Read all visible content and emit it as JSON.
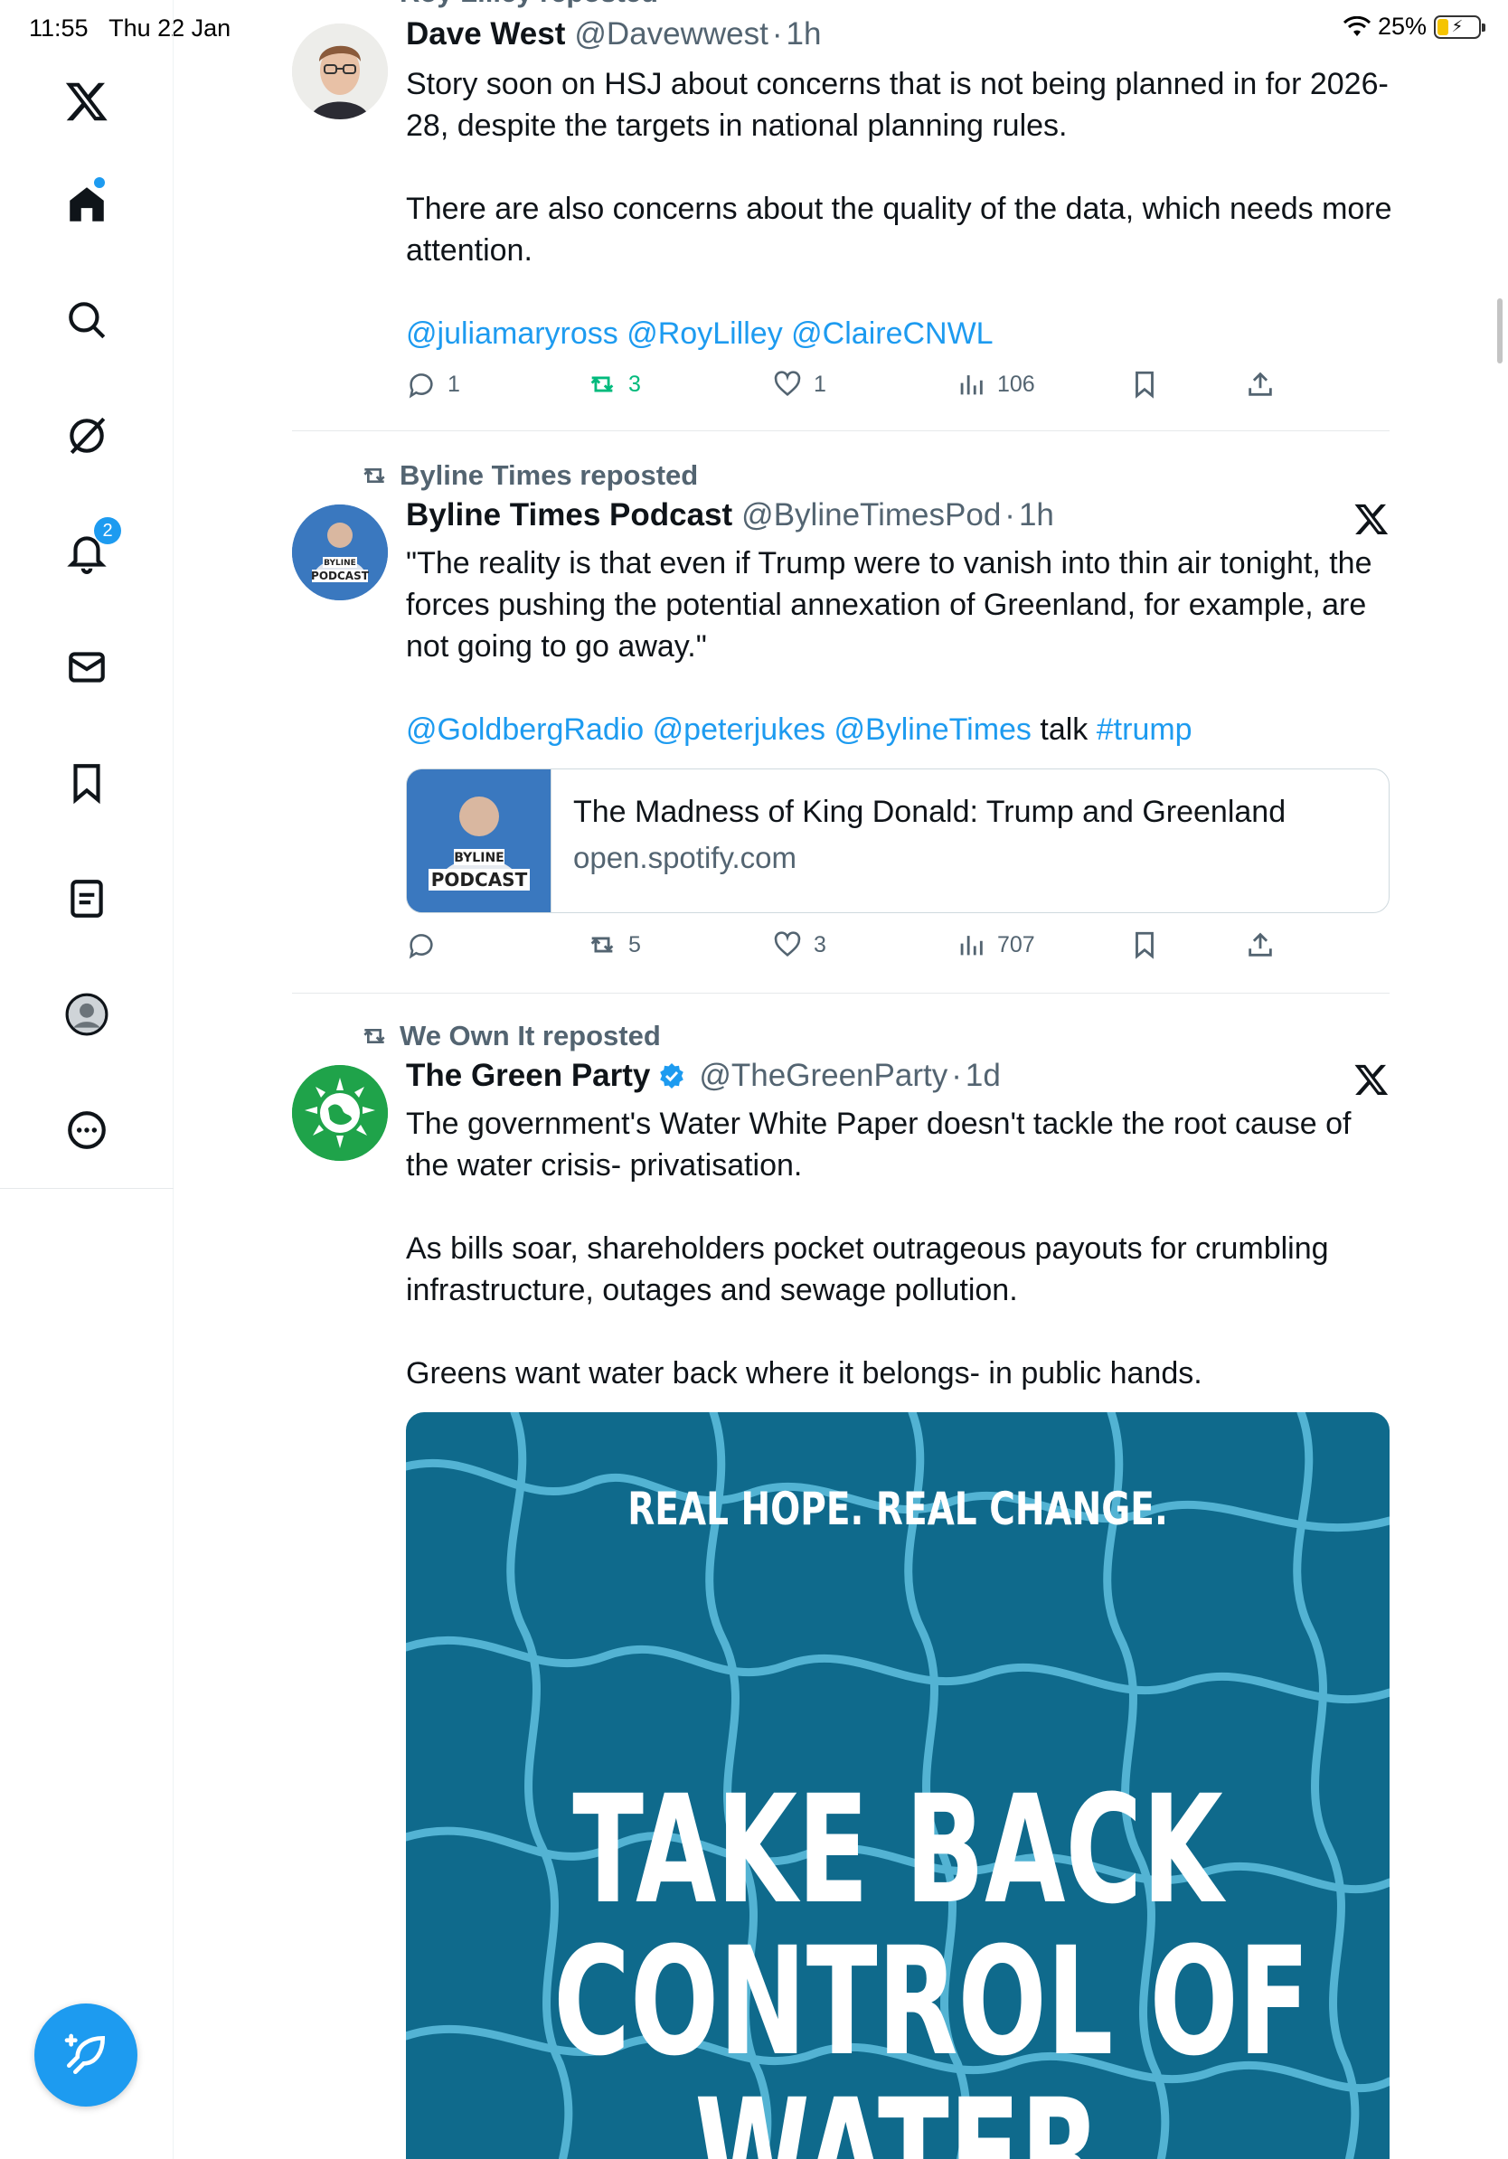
{
  "status_bar": {
    "time": "11:55",
    "date": "Thu 22 Jan",
    "battery": "25%",
    "battery_level": 0.25
  },
  "sidebar": {
    "notification_count": "2",
    "items": [
      {
        "name": "home"
      },
      {
        "name": "search"
      },
      {
        "name": "grok"
      },
      {
        "name": "notifications"
      },
      {
        "name": "messages"
      },
      {
        "name": "bookmarks"
      },
      {
        "name": "lists"
      },
      {
        "name": "profile"
      },
      {
        "name": "more"
      }
    ]
  },
  "tweets": [
    {
      "repost_by": "Roy Lilley reposted",
      "name": "Dave West",
      "handle": "@Davewwest",
      "time": "1h",
      "paragraphs": [
        "Story soon on HSJ about concerns that is not being planned in for 2026-28, despite the targets in national planning rules.",
        "There are also concerns about the quality of the data, which needs more attention."
      ],
      "mentions": [
        "@juliamaryross",
        "@RoyLilley",
        "@ClaireCNWL"
      ],
      "replies": "1",
      "reposts": "3",
      "likes": "1",
      "views": "106"
    },
    {
      "repost_by": "Byline Times reposted",
      "name": "Byline Times Podcast",
      "handle": "@BylineTimesPod",
      "time": "1h",
      "avatar_text": [
        "BYLINE",
        "PODCAST"
      ],
      "paragraphs": [
        "\"The reality is that even if Trump were to vanish into thin air tonight, the forces pushing the potential annexation of Greenland, for example, are not going to go away.\""
      ],
      "mention_line": [
        "@GoldbergRadio",
        "@peterjukes",
        "@BylineTimes",
        "talk",
        "#trump"
      ],
      "card": {
        "title": "The Madness of King Donald: Trump and Greenland",
        "domain": "open.spotify.com"
      },
      "replies": "",
      "reposts": "5",
      "likes": "3",
      "views": "707"
    },
    {
      "repost_by": "We Own It reposted",
      "name": "The Green Party",
      "handle": "@TheGreenParty",
      "time": "1d",
      "paragraphs": [
        "The government's Water White Paper doesn't tackle the root cause of the water crisis- privatisation.",
        "As bills soar, shareholders pocket outrageous payouts for crumbling infrastructure, outages and sewage pollution.",
        "Greens want water back where it belongs- in public hands."
      ],
      "media": {
        "small_text": "REAL HOPE. REAL CHANGE.",
        "big_lines": [
          "TAKE BACK",
          "CONTROL OF",
          "WATER"
        ]
      }
    }
  ],
  "colors": {
    "accent": "#1d9bf0",
    "repost_green": "#00ba7c",
    "muted": "#536471",
    "media_bg": "#0f6a8c",
    "green_party": "#1fa34a"
  }
}
